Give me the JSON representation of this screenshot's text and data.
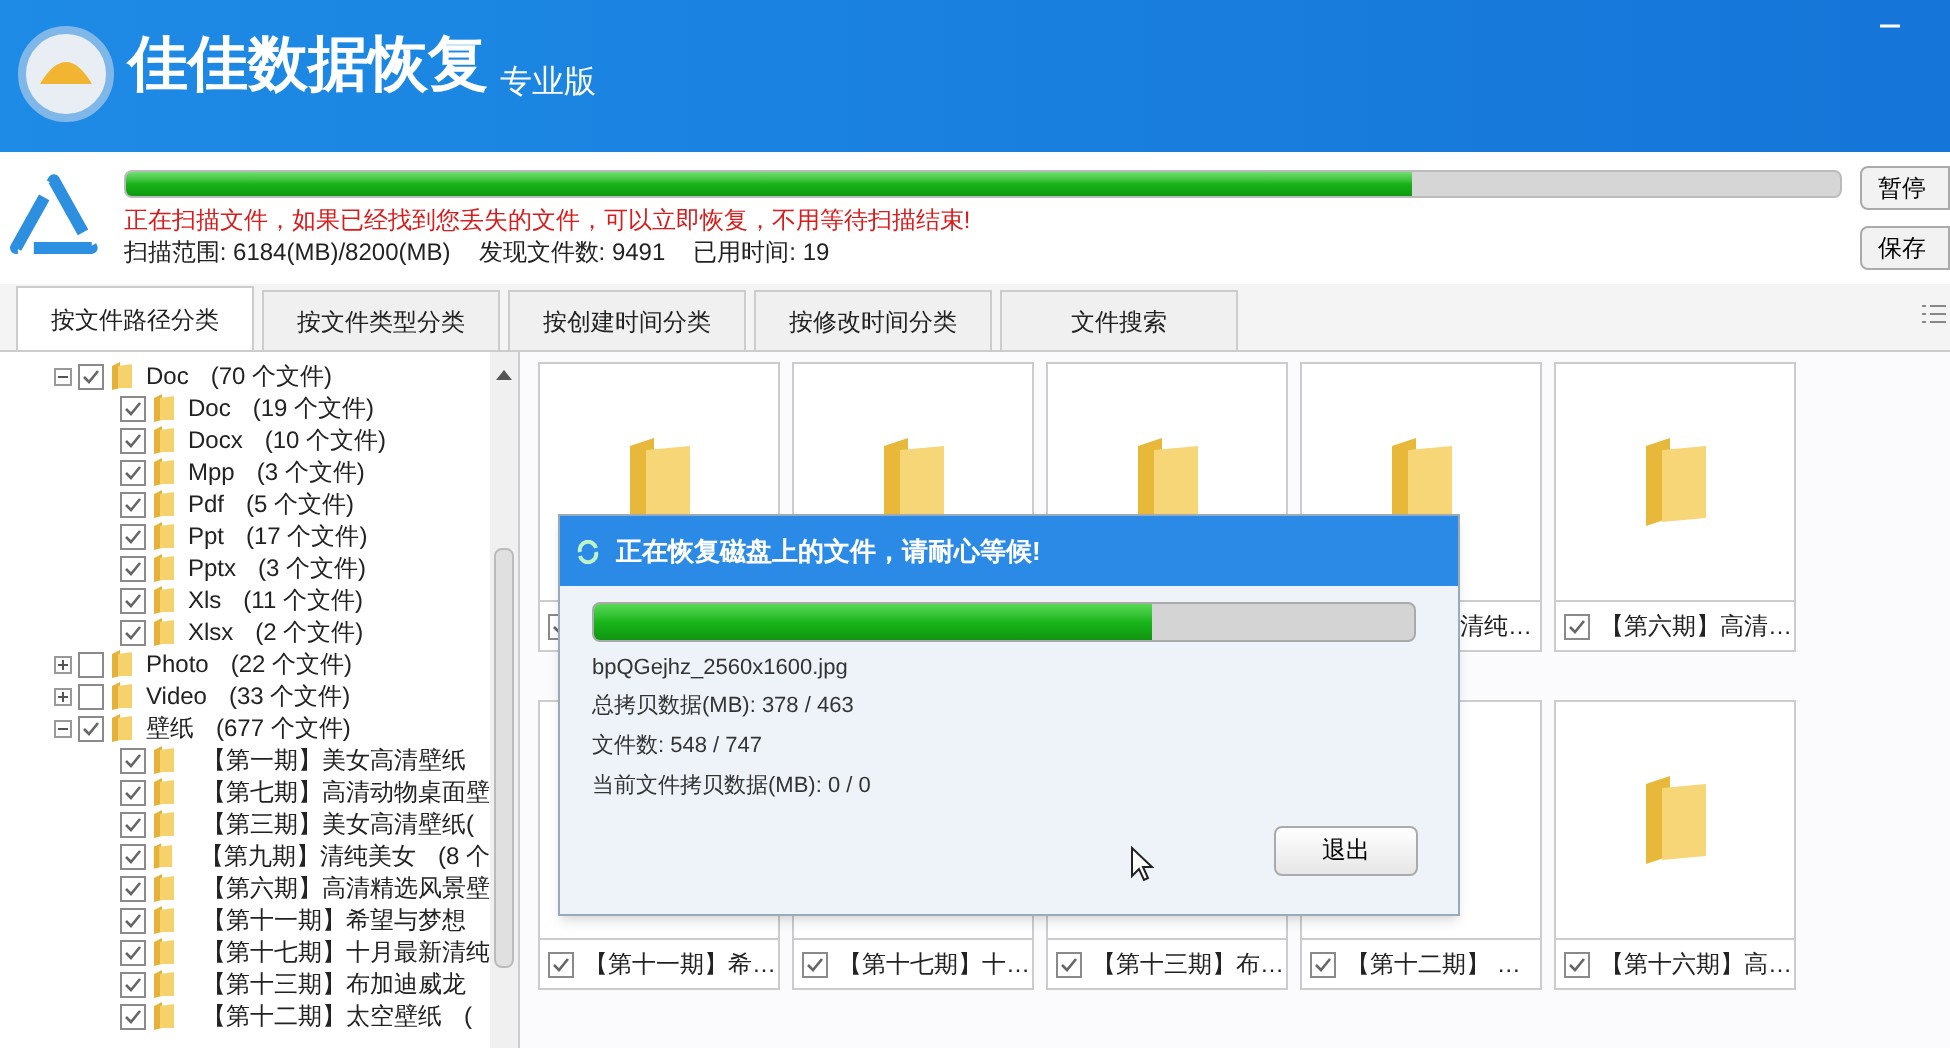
{
  "app": {
    "title": "佳佳数据恢复",
    "edition": "专业版"
  },
  "scan": {
    "level": 0.75,
    "message": "正在扫描文件，如果已经找到您丢失的文件，可以立即恢复，不用等待扫描结束!",
    "range_label": "扫描范围:",
    "range_value": "6184(MB)/8200(MB)",
    "found_label": "发现文件数:",
    "found_value": "9491",
    "time_label": "已用时间:",
    "time_value": "19",
    "buttons": [
      "暂停",
      "保存"
    ]
  },
  "tabs": [
    {
      "label": "按文件路径分类",
      "selected": true
    },
    {
      "label": "按文件类型分类",
      "selected": false
    },
    {
      "label": "按创建时间分类",
      "selected": false
    },
    {
      "label": "按修改时间分类",
      "selected": false
    },
    {
      "label": "文件搜索",
      "selected": false
    }
  ],
  "tree": [
    {
      "name": "Doc",
      "count": "(70 个文件)",
      "checked": true,
      "expanded": true,
      "children": [
        {
          "name": "Doc",
          "count": "(19 个文件)",
          "checked": true
        },
        {
          "name": "Docx",
          "count": "(10 个文件)",
          "checked": true
        },
        {
          "name": "Mpp",
          "count": "(3 个文件)",
          "checked": true
        },
        {
          "name": "Pdf",
          "count": "(5 个文件)",
          "checked": true
        },
        {
          "name": "Ppt",
          "count": "(17 个文件)",
          "checked": true
        },
        {
          "name": "Pptx",
          "count": "(3 个文件)",
          "checked": true
        },
        {
          "name": "Xls",
          "count": "(11 个文件)",
          "checked": true
        },
        {
          "name": "Xlsx",
          "count": "(2 个文件)",
          "checked": true
        }
      ]
    },
    {
      "name": "Photo",
      "count": "(22 个文件)",
      "checked": false,
      "expanded": false
    },
    {
      "name": "Video",
      "count": "(33 个文件)",
      "checked": false,
      "expanded": false
    },
    {
      "name": "壁纸",
      "count": "(677 个文件)",
      "checked": true,
      "expanded": true,
      "children": [
        {
          "name": "【第一期】美女高清壁纸",
          "checked": true
        },
        {
          "name": "【第七期】高清动物桌面壁",
          "checked": true
        },
        {
          "name": "【第三期】美女高清壁纸(",
          "checked": true
        },
        {
          "name": "【第九期】清纯美女",
          "count": "(8 个",
          "checked": true
        },
        {
          "name": "【第六期】高清精选风景壁",
          "checked": true
        },
        {
          "name": "【第十一期】希望与梦想",
          "checked": true
        },
        {
          "name": "【第十七期】十月最新清纯",
          "checked": true
        },
        {
          "name": "【第十三期】布加迪威龙",
          "checked": true
        },
        {
          "name": "【第十二期】太空壁纸",
          "count": "(",
          "checked": true
        }
      ]
    }
  ],
  "grid": [
    [
      {
        "kind": "folder",
        "checked": true
      },
      {
        "kind": "folder"
      },
      {
        "kind": "folder"
      },
      {
        "kind": "folder",
        "caption": "清纯…"
      },
      {
        "kind": "folder",
        "caption": "【第六期】高清…",
        "checked": true
      }
    ],
    [
      {
        "kind": "folder",
        "caption": "【第十一期】希…",
        "checked": true
      },
      {
        "kind": "folder",
        "caption": "【第十七期】十…",
        "checked": true
      },
      {
        "kind": "folder",
        "caption": "【第十三期】布…",
        "checked": true
      },
      {
        "kind": "folder",
        "caption": "【第十二期】 …",
        "checked": true
      },
      {
        "kind": "folder",
        "caption": "【第十六期】高…",
        "checked": true
      }
    ]
  ],
  "dialog": {
    "title": "正在恢复磁盘上的文件，请耐心等候!",
    "level": 0.68,
    "file": "bpQGejhz_2560x1600.jpg",
    "lines": [
      "总拷贝数据(MB): 378 / 463",
      "文件数: 548 / 747",
      "当前文件拷贝数据(MB): 0 / 0"
    ],
    "button": "退出"
  }
}
